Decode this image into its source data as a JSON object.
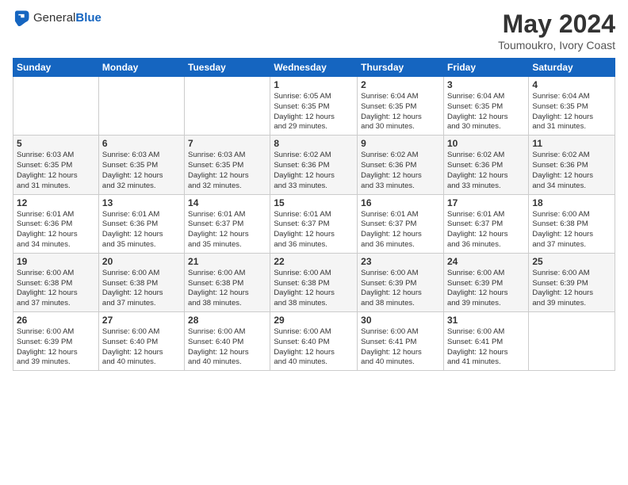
{
  "header": {
    "logo_general": "General",
    "logo_blue": "Blue",
    "title": "May 2024",
    "location": "Toumoukro, Ivory Coast"
  },
  "weekdays": [
    "Sunday",
    "Monday",
    "Tuesday",
    "Wednesday",
    "Thursday",
    "Friday",
    "Saturday"
  ],
  "weeks": [
    [
      {
        "day": "",
        "info": ""
      },
      {
        "day": "",
        "info": ""
      },
      {
        "day": "",
        "info": ""
      },
      {
        "day": "1",
        "info": "Sunrise: 6:05 AM\nSunset: 6:35 PM\nDaylight: 12 hours\nand 29 minutes."
      },
      {
        "day": "2",
        "info": "Sunrise: 6:04 AM\nSunset: 6:35 PM\nDaylight: 12 hours\nand 30 minutes."
      },
      {
        "day": "3",
        "info": "Sunrise: 6:04 AM\nSunset: 6:35 PM\nDaylight: 12 hours\nand 30 minutes."
      },
      {
        "day": "4",
        "info": "Sunrise: 6:04 AM\nSunset: 6:35 PM\nDaylight: 12 hours\nand 31 minutes."
      }
    ],
    [
      {
        "day": "5",
        "info": "Sunrise: 6:03 AM\nSunset: 6:35 PM\nDaylight: 12 hours\nand 31 minutes."
      },
      {
        "day": "6",
        "info": "Sunrise: 6:03 AM\nSunset: 6:35 PM\nDaylight: 12 hours\nand 32 minutes."
      },
      {
        "day": "7",
        "info": "Sunrise: 6:03 AM\nSunset: 6:35 PM\nDaylight: 12 hours\nand 32 minutes."
      },
      {
        "day": "8",
        "info": "Sunrise: 6:02 AM\nSunset: 6:36 PM\nDaylight: 12 hours\nand 33 minutes."
      },
      {
        "day": "9",
        "info": "Sunrise: 6:02 AM\nSunset: 6:36 PM\nDaylight: 12 hours\nand 33 minutes."
      },
      {
        "day": "10",
        "info": "Sunrise: 6:02 AM\nSunset: 6:36 PM\nDaylight: 12 hours\nand 33 minutes."
      },
      {
        "day": "11",
        "info": "Sunrise: 6:02 AM\nSunset: 6:36 PM\nDaylight: 12 hours\nand 34 minutes."
      }
    ],
    [
      {
        "day": "12",
        "info": "Sunrise: 6:01 AM\nSunset: 6:36 PM\nDaylight: 12 hours\nand 34 minutes."
      },
      {
        "day": "13",
        "info": "Sunrise: 6:01 AM\nSunset: 6:36 PM\nDaylight: 12 hours\nand 35 minutes."
      },
      {
        "day": "14",
        "info": "Sunrise: 6:01 AM\nSunset: 6:37 PM\nDaylight: 12 hours\nand 35 minutes."
      },
      {
        "day": "15",
        "info": "Sunrise: 6:01 AM\nSunset: 6:37 PM\nDaylight: 12 hours\nand 36 minutes."
      },
      {
        "day": "16",
        "info": "Sunrise: 6:01 AM\nSunset: 6:37 PM\nDaylight: 12 hours\nand 36 minutes."
      },
      {
        "day": "17",
        "info": "Sunrise: 6:01 AM\nSunset: 6:37 PM\nDaylight: 12 hours\nand 36 minutes."
      },
      {
        "day": "18",
        "info": "Sunrise: 6:00 AM\nSunset: 6:38 PM\nDaylight: 12 hours\nand 37 minutes."
      }
    ],
    [
      {
        "day": "19",
        "info": "Sunrise: 6:00 AM\nSunset: 6:38 PM\nDaylight: 12 hours\nand 37 minutes."
      },
      {
        "day": "20",
        "info": "Sunrise: 6:00 AM\nSunset: 6:38 PM\nDaylight: 12 hours\nand 37 minutes."
      },
      {
        "day": "21",
        "info": "Sunrise: 6:00 AM\nSunset: 6:38 PM\nDaylight: 12 hours\nand 38 minutes."
      },
      {
        "day": "22",
        "info": "Sunrise: 6:00 AM\nSunset: 6:38 PM\nDaylight: 12 hours\nand 38 minutes."
      },
      {
        "day": "23",
        "info": "Sunrise: 6:00 AM\nSunset: 6:39 PM\nDaylight: 12 hours\nand 38 minutes."
      },
      {
        "day": "24",
        "info": "Sunrise: 6:00 AM\nSunset: 6:39 PM\nDaylight: 12 hours\nand 39 minutes."
      },
      {
        "day": "25",
        "info": "Sunrise: 6:00 AM\nSunset: 6:39 PM\nDaylight: 12 hours\nand 39 minutes."
      }
    ],
    [
      {
        "day": "26",
        "info": "Sunrise: 6:00 AM\nSunset: 6:39 PM\nDaylight: 12 hours\nand 39 minutes."
      },
      {
        "day": "27",
        "info": "Sunrise: 6:00 AM\nSunset: 6:40 PM\nDaylight: 12 hours\nand 40 minutes."
      },
      {
        "day": "28",
        "info": "Sunrise: 6:00 AM\nSunset: 6:40 PM\nDaylight: 12 hours\nand 40 minutes."
      },
      {
        "day": "29",
        "info": "Sunrise: 6:00 AM\nSunset: 6:40 PM\nDaylight: 12 hours\nand 40 minutes."
      },
      {
        "day": "30",
        "info": "Sunrise: 6:00 AM\nSunset: 6:41 PM\nDaylight: 12 hours\nand 40 minutes."
      },
      {
        "day": "31",
        "info": "Sunrise: 6:00 AM\nSunset: 6:41 PM\nDaylight: 12 hours\nand 41 minutes."
      },
      {
        "day": "",
        "info": ""
      }
    ]
  ]
}
